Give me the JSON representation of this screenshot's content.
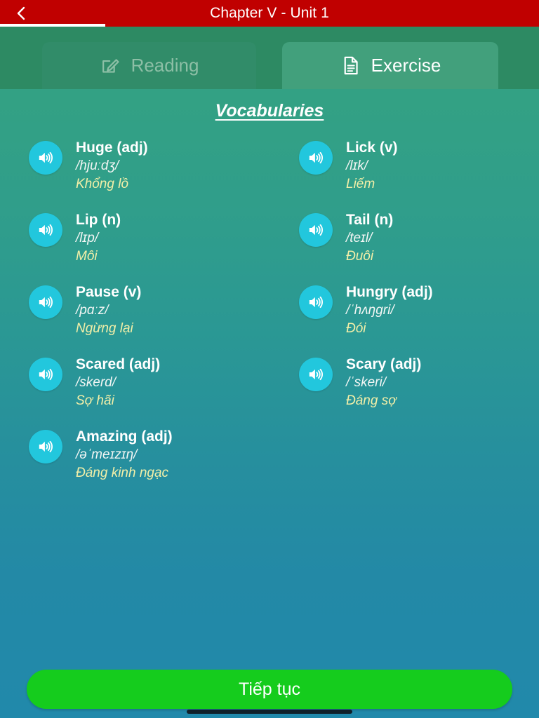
{
  "header": {
    "title": "Chapter V - Unit 1",
    "back_icon": "chevron-left-icon",
    "progress_percent": 19.5,
    "bar_color": "#c00000"
  },
  "tabs": [
    {
      "id": "reading",
      "label": "Reading",
      "icon": "edit-pencil-icon",
      "active": false
    },
    {
      "id": "exercise",
      "label": "Exercise",
      "icon": "document-lines-icon",
      "active": true
    }
  ],
  "main": {
    "section_title": "Vocabularies",
    "speaker_icon": "speaker-volume-icon",
    "vocabularies": [
      {
        "word": "Huge (adj)",
        "ipa": "/hjuːdʒ/",
        "vi": "Khổng lồ"
      },
      {
        "word": "Lick (v)",
        "ipa": "/lɪk/",
        "vi": "Liếm"
      },
      {
        "word": "Lip (n)",
        "ipa": "/lɪp/",
        "vi": "Môi"
      },
      {
        "word": "Tail (n)",
        "ipa": "/teɪl/",
        "vi": "Đuôi"
      },
      {
        "word": "Pause (v)",
        "ipa": "/pɑːz/",
        "vi": "Ngừng lại"
      },
      {
        "word": "Hungry (adj)",
        "ipa": "/ˈhʌŋgri/",
        "vi": "Đói"
      },
      {
        "word": "Scared (adj)",
        "ipa": "/skerd/",
        "vi": "Sợ hãi"
      },
      {
        "word": "Scary (adj)",
        "ipa": "/ˈskeri/",
        "vi": "Đáng sợ"
      },
      {
        "word": "Amazing (adj)",
        "ipa": "/əˈmeɪzɪŋ/",
        "vi": "Đáng kinh ngạc"
      }
    ]
  },
  "footer": {
    "continue_label": "Tiếp tục",
    "continue_color": "#15cc1d"
  },
  "colors": {
    "accent_cyan": "#22c7dd",
    "translation_yellow": "#f2efa8",
    "bg_top": "#35a083",
    "bg_bottom": "#2189ab"
  }
}
